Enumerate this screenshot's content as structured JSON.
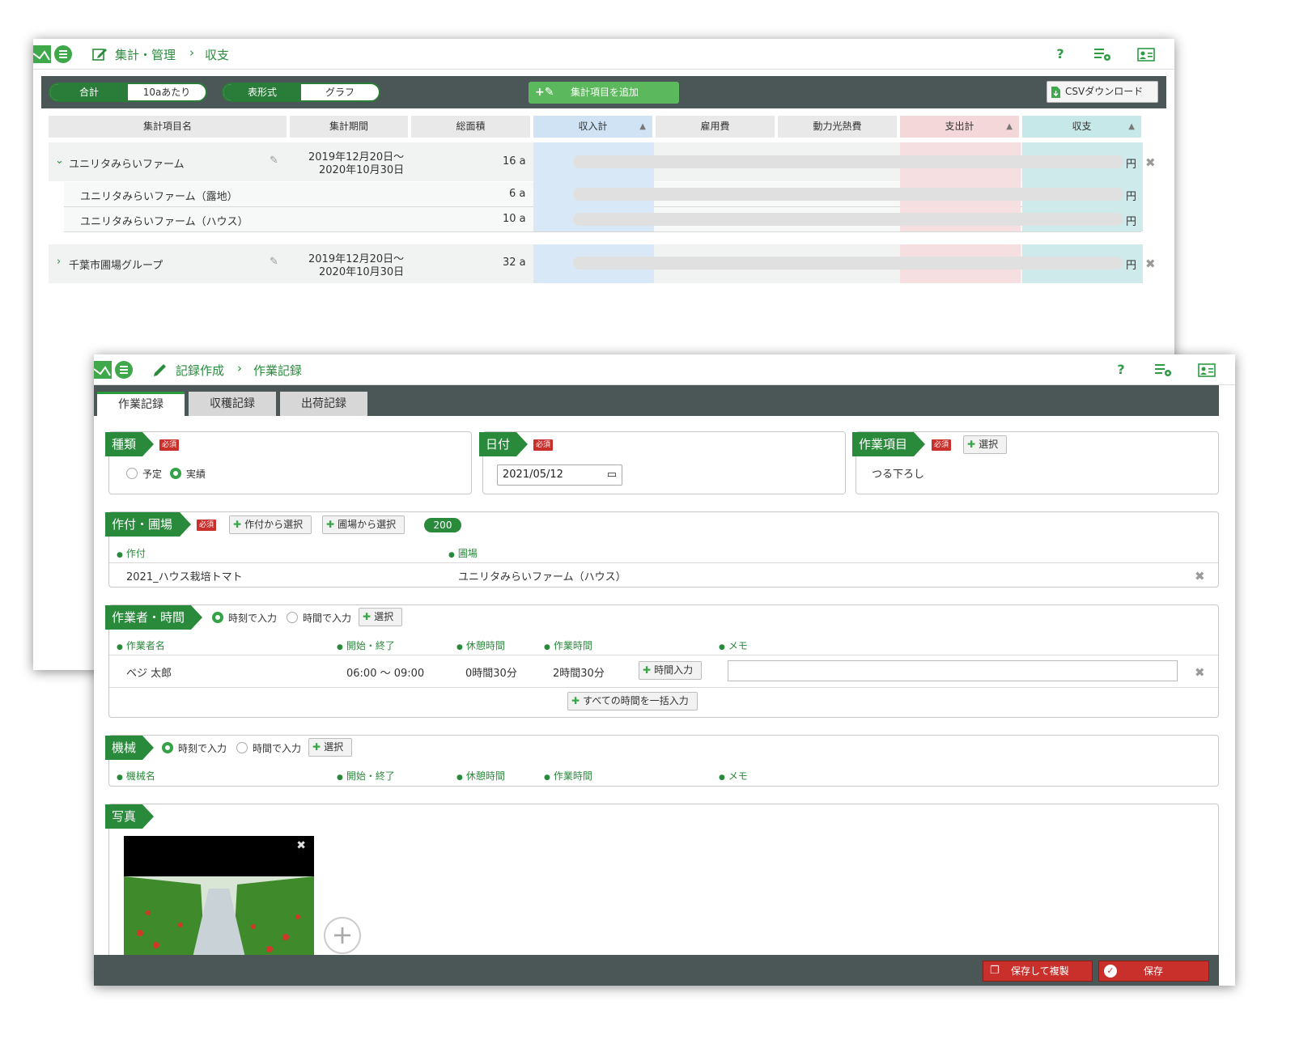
{
  "summary_window": {
    "breadcrumb": {
      "section": "集計・管理",
      "page": "収支"
    },
    "help_label": "?",
    "view_toggle": {
      "total": "合計",
      "per_10a": "10aあたり"
    },
    "format_toggle": {
      "table": "表形式",
      "graph": "グラフ"
    },
    "add_item_label": "集計項目を追加",
    "csv_label": "CSVダウンロード",
    "columns": [
      "集計項目名",
      "集計期間",
      "総面積",
      "収入計",
      "雇用費",
      "動力光熱費",
      "支出計",
      "収支"
    ],
    "groups": [
      {
        "name": "ユニリタみらいファーム",
        "period_start": "2019年12月20日〜",
        "period_end": "2020年10月30日",
        "area": "16 a",
        "unit": "円",
        "children": [
          {
            "name": "ユニリタみらいファーム（露地）",
            "area": "6 a",
            "unit": "円"
          },
          {
            "name": "ユニリタみらいファーム（ハウス）",
            "area": "10 a",
            "unit": "円"
          }
        ]
      },
      {
        "name": "千葉市圃場グループ",
        "period_start": "2019年12月20日〜",
        "period_end": "2020年10月30日",
        "area": "32 a",
        "unit": "円"
      }
    ]
  },
  "record_window": {
    "breadcrumb": {
      "section": "記録作成",
      "page": "作業記録"
    },
    "help_label": "?",
    "tabs": [
      "作業記録",
      "収穫記録",
      "出荷記録"
    ],
    "required_label": "必須",
    "select_label": "選択",
    "type_panel": {
      "title": "種類",
      "options": [
        "予定",
        "実績"
      ],
      "selected": "実績"
    },
    "date_panel": {
      "title": "日付",
      "value": "2021/05/12"
    },
    "work_item_panel": {
      "title": "作業項目",
      "value": "つる下ろし"
    },
    "crop_panel": {
      "title": "作付・圃場",
      "from_crop": "作付から選択",
      "from_field": "圃場から選択",
      "count": "200",
      "headers": [
        "作付",
        "圃場"
      ],
      "row": {
        "crop": "2021_ハウス栽培トマト",
        "field": "ユニリタみらいファーム（ハウス）"
      }
    },
    "worker_panel": {
      "title": "作業者・時間",
      "options": [
        "時刻で入力",
        "時間で入力"
      ],
      "selected": "時刻で入力",
      "headers": [
        "作業者名",
        "開始・終了",
        "休憩時間",
        "作業時間",
        "メモ"
      ],
      "row": {
        "name": "ベジ 太郎",
        "start_end": "06:00 〜 09:00",
        "break": "0時間30分",
        "work": "2時間30分",
        "time_input": "時間入力"
      },
      "bulk_input": "すべての時間を一括入力"
    },
    "machine_panel": {
      "title": "機械",
      "options": [
        "時刻で入力",
        "時間で入力"
      ],
      "selected": "時刻で入力",
      "headers": [
        "機械名",
        "開始・終了",
        "休憩時間",
        "作業時間",
        "メモ"
      ]
    },
    "photo_panel": {
      "title": "写真"
    },
    "footer": {
      "save_copy": "保存して複製",
      "save": "保存"
    }
  }
}
